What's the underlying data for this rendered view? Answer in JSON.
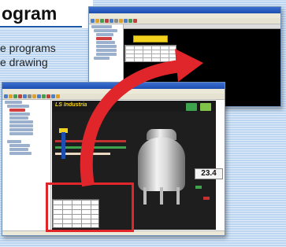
{
  "heading": {
    "title": "ogram",
    "lines": [
      "e programs",
      "e drawing"
    ]
  },
  "back_window": {
    "title": "",
    "menu": [
      "",
      "",
      "",
      "",
      "",
      ""
    ]
  },
  "front_window": {
    "title": "",
    "menu": [
      "",
      "",
      "",
      "",
      "",
      ""
    ],
    "header_text": "LS Industria",
    "readout_value": "23.4",
    "readout_unit": "",
    "readout_label": ""
  },
  "colors": {
    "accent_red": "#e0262a",
    "title_rule": "#1a57a8",
    "screen_bg": "#1e1e1e",
    "label_yellow": "#f2d21c"
  },
  "icons": [
    "arrow-curve-icon"
  ]
}
